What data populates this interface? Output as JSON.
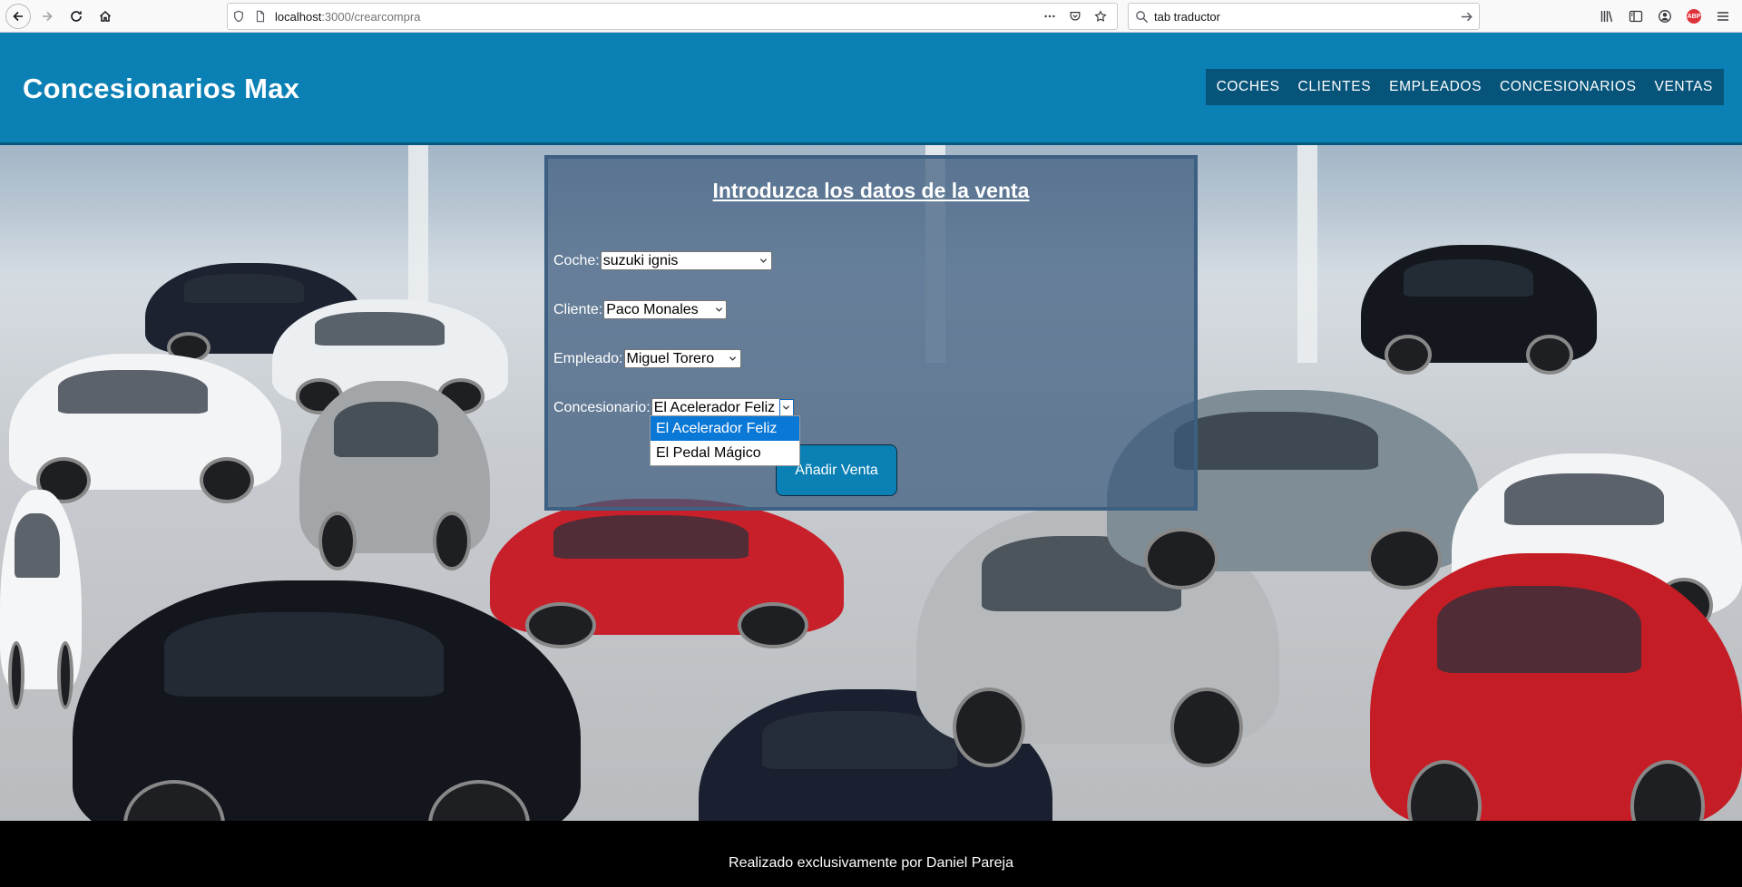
{
  "browser": {
    "url_host": "localhost",
    "url_path": ":3000/crearcompra",
    "search_value": "tab traductor",
    "abp_badge": "ABP"
  },
  "header": {
    "title": "Concesionarios Max",
    "nav": [
      "COCHES",
      "CLIENTES",
      "EMPLEADOS",
      "CONCESIONARIOS",
      "VENTAS"
    ]
  },
  "form": {
    "title": "Introduzca los datos de la venta",
    "fields": [
      {
        "label": "Coche:",
        "value": "suzuki ignis"
      },
      {
        "label": "Cliente:",
        "value": "Paco Monales"
      },
      {
        "label": "Empleado:",
        "value": "Miguel Torero"
      },
      {
        "label": "Concesionario:",
        "value": "El Acelerador Feliz"
      }
    ],
    "dropdown_options": [
      "El Acelerador Feliz",
      "El Pedal Mágico"
    ],
    "submit_label": "Añadir Venta"
  },
  "footer": {
    "text": "Realizado exclusivamente por Daniel Pareja"
  },
  "colors": {
    "header_bg": "#0a80b5",
    "nav_bg": "#07547a",
    "footer_bg": "#000000",
    "dropdown_selected": "#0a78d7"
  }
}
